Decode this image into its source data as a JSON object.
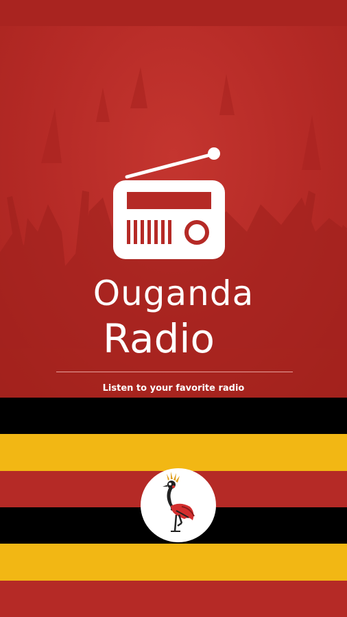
{
  "app": {
    "title_line1": "Ouganda",
    "title_line2": "Radio",
    "tagline": "Listen to your favorite radio"
  },
  "icons": {
    "logo": "radio-icon",
    "emblem": "crested-crane-icon"
  },
  "colors": {
    "background_red": "#b52a26",
    "status_bar": "#a92420",
    "flag_black": "#000000",
    "flag_yellow": "#f2b714",
    "flag_red": "#b52a26",
    "text": "#ffffff"
  },
  "flag": {
    "stripes": [
      "#000000",
      "#f2b714",
      "#b52a26",
      "#000000",
      "#f2b714",
      "#b52a26"
    ]
  }
}
